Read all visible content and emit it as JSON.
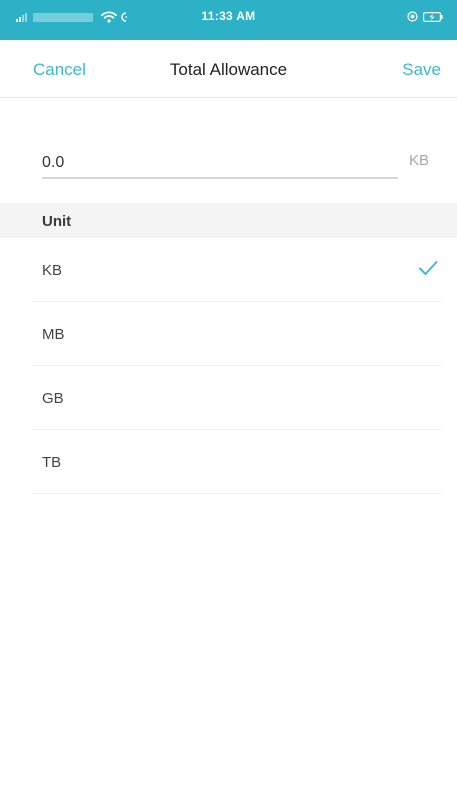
{
  "status_bar": {
    "time": "11:33 AM",
    "background_color": "#2cb1c6",
    "icons": [
      "signal-icon",
      "wifi-icon",
      "loading-icon",
      "orientation-lock-icon",
      "battery-charging-icon"
    ]
  },
  "nav": {
    "cancel_label": "Cancel",
    "title": "Total Allowance",
    "save_label": "Save",
    "accent_color": "#41b8c8"
  },
  "allowance": {
    "value": "0.0",
    "unit": "KB"
  },
  "unit_section": {
    "header": "Unit",
    "options": [
      {
        "label": "KB",
        "selected": true
      },
      {
        "label": "MB",
        "selected": false
      },
      {
        "label": "GB",
        "selected": false
      },
      {
        "label": "TB",
        "selected": false
      }
    ],
    "check_icon": "checkmark-icon"
  }
}
